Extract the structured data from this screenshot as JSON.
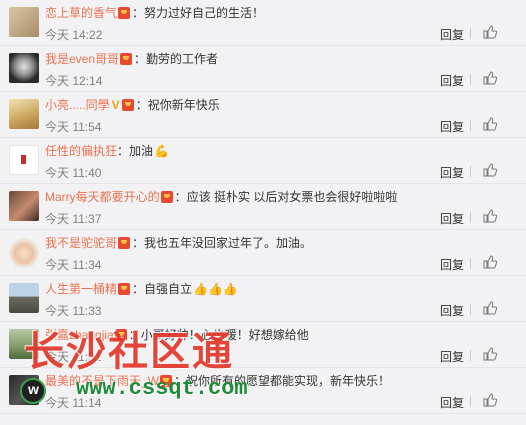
{
  "reply_label": "回复",
  "colors": {
    "username": "#eb7350",
    "time": "#808080",
    "watermark_red": "#e2382a",
    "watermark_green": "#1f8b37"
  },
  "comments": [
    {
      "user": "恋上草的香气",
      "sep": "：",
      "text": "努力过好自己的生活！",
      "time": "今天 14:22",
      "emoji": ""
    },
    {
      "user": "我是even哥哥",
      "sep": "：",
      "text": "勤劳的工作者",
      "time": "今天 12:14",
      "emoji": ""
    },
    {
      "user": "小亮.....同學",
      "sep": "：",
      "text": "祝你新年快乐",
      "time": "今天 11:54",
      "emoji": ""
    },
    {
      "user": "任性的偏执狂",
      "sep": "：",
      "text": "加油",
      "time": "今天 11:40",
      "emoji": "💪"
    },
    {
      "user": "Marry每天都要开心的",
      "sep": "：",
      "text": "应该 挺朴实 以后对女票也会很好啦啦啦",
      "time": "今天 11:37",
      "emoji": ""
    },
    {
      "user": "我不是驼驼哥",
      "sep": "：",
      "text": "我也五年没回家过年了。加油。",
      "time": "今天 11:34",
      "emoji": ""
    },
    {
      "user": "人生第一桶精",
      "sep": "：",
      "text": "自强自立",
      "time": "今天 11:33",
      "emoji": "👍👍👍"
    },
    {
      "user": "张嘉zhangjia",
      "sep": "：",
      "text": "小哥好帅！心也暖！好想嫁给他",
      "time": "今天 11:31",
      "emoji": ""
    },
    {
      "user": "最美的不是下雨天_W",
      "sep": "：",
      "text": "祝你所有的愿望都能实现，新年快乐！",
      "time": "今天 11:14",
      "emoji": ""
    }
  ],
  "watermark": {
    "title": "长沙社区通",
    "url": "www.cssqt.com"
  }
}
